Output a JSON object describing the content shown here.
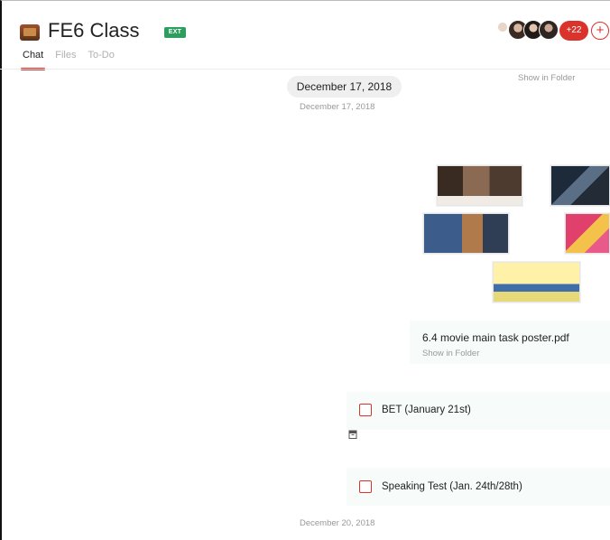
{
  "header": {
    "group_title": "FE6 Class",
    "ext_badge": "EXT",
    "tabs": [
      {
        "label": "Chat",
        "active": true
      },
      {
        "label": "Files",
        "active": false
      },
      {
        "label": "To-Do",
        "active": false
      }
    ],
    "members_more": "+22",
    "add_label": "+",
    "accent_color": "#d9332b"
  },
  "messages": {
    "date_pill": "December 17, 2018",
    "date_sub": "December 17, 2018",
    "show_in_folder_top": "Show in Folder",
    "file": {
      "name": "6.4 movie main task poster.pdf",
      "show_in_folder": "Show in Folder"
    },
    "todos": [
      {
        "label": "BET (January 21st)"
      },
      {
        "label": "Speaking Test (Jan. 24th/28th)"
      }
    ],
    "date_bottom": "December 20, 2018"
  }
}
